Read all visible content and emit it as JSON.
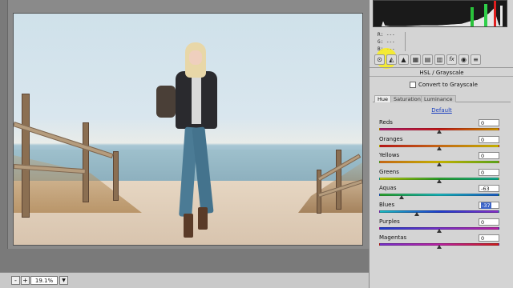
{
  "panel": {
    "readout": {
      "r": "R:  ---",
      "g": "G:  ---",
      "b": "B:  ---"
    },
    "title": "HSL / Grayscale",
    "convert_label": "Convert to Grayscale",
    "tabs": [
      "Hue",
      "Saturation",
      "Luminance"
    ],
    "active_tab": "Hue",
    "default_label": "Default",
    "sliders": [
      {
        "label": "Reds",
        "value": "0",
        "level": 0,
        "colors": [
          "#c0207a",
          "#d51b1b",
          "#e0a000"
        ]
      },
      {
        "label": "Oranges",
        "value": "0",
        "level": 0,
        "colors": [
          "#d51b1b",
          "#e87a1a",
          "#e6d000"
        ]
      },
      {
        "label": "Yellows",
        "value": "0",
        "level": 0,
        "colors": [
          "#e87a1a",
          "#e6d000",
          "#6bbf1f"
        ]
      },
      {
        "label": "Greens",
        "value": "0",
        "level": 0,
        "colors": [
          "#c9d400",
          "#2fae2f",
          "#13b6a0"
        ]
      },
      {
        "label": "Aquas",
        "value": "-63",
        "level": -63,
        "colors": [
          "#2fae2f",
          "#19c0c8",
          "#1f64d2"
        ]
      },
      {
        "label": "Blues",
        "value": "-37",
        "level": -37,
        "colors": [
          "#19c0c8",
          "#1f3fd6",
          "#8a2fd0"
        ]
      },
      {
        "label": "Purples",
        "value": "0",
        "level": 0,
        "colors": [
          "#1f3fd6",
          "#7a2fd0",
          "#c020a8"
        ]
      },
      {
        "label": "Magentas",
        "value": "0",
        "level": 0,
        "colors": [
          "#7a2fd0",
          "#c020a8",
          "#d51b1b"
        ]
      }
    ],
    "selected_slider": "Blues",
    "toolbar_icons": [
      "basic-icon",
      "tone-curve-icon",
      "detail-icon",
      "hsl-icon",
      "split-toning-icon",
      "lens-icon",
      "fx-icon",
      "camera-calibration-icon",
      "presets-icon"
    ],
    "highlight_color": "#fff200"
  },
  "status": {
    "zoom": "19.1%",
    "zoom_out": "-",
    "zoom_in": "+",
    "dropdown": "▼"
  }
}
